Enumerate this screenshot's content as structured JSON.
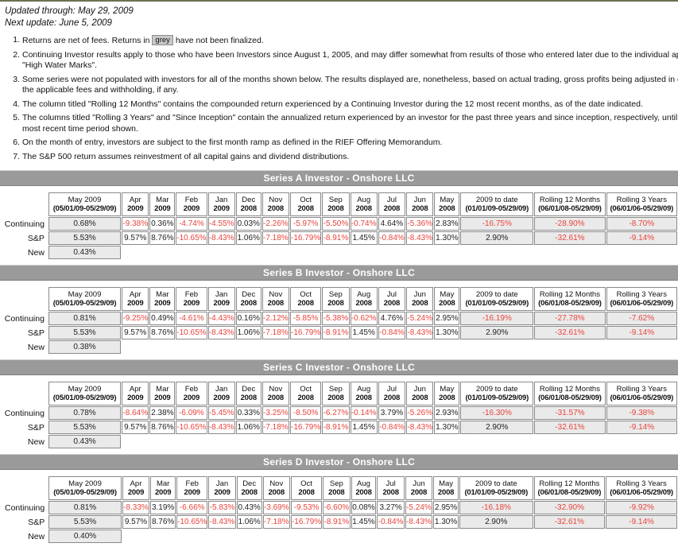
{
  "header": {
    "updated_through": "Updated through: May 29, 2009",
    "next_update": "Next update: June 5, 2009"
  },
  "notes": [
    {
      "num": "1.",
      "pre": "Returns are net of fees. Returns in ",
      "chip": "grey",
      "post": " have not been finalized."
    },
    {
      "num": "2.",
      "pre": "Continuing Investor results apply to those who have been Investors since August 1, 2005, and may differ somewhat from results of those who entered later due to the individual application of \"High Water Marks\".",
      "chip": "",
      "post": ""
    },
    {
      "num": "3.",
      "pre": "Some series were not populated with investors for all of the months shown below. The results displayed are, nonetheless, based on actual trading, gross profits being adjusted in each case by the applicable fees and withholding, if any.",
      "chip": "",
      "post": ""
    },
    {
      "num": "4.",
      "pre": "The column titled \"Rolling 12 Months\" contains the compounded return experienced by a Continuing Investor during the 12 most recent months, as of the date indicated.",
      "chip": "",
      "post": ""
    },
    {
      "num": "5.",
      "pre": "The columns titled \"Rolling 3 Years\" and \"Since Inception\" contain the annualized return experienced by an investor for the past three years and since inception, respectively, until the end of the most recent time period shown.",
      "chip": "",
      "post": ""
    },
    {
      "num": "6.",
      "pre": "On the month of entry, investors are subject to the first month ramp as defined in the RIEF Offering Memorandum.",
      "chip": "",
      "post": ""
    },
    {
      "num": "7.",
      "pre": "The S&P 500 return assumes reinvestment of all capital gains and dividend distributions.",
      "chip": "",
      "post": ""
    }
  ],
  "columns": {
    "may": {
      "line1": "May 2009",
      "line2": "(05/01/09-05/29/09)"
    },
    "months": [
      {
        "line1": "Apr",
        "line2": "2009"
      },
      {
        "line1": "Mar",
        "line2": "2009"
      },
      {
        "line1": "Feb",
        "line2": "2009"
      },
      {
        "line1": "Jan",
        "line2": "2009"
      },
      {
        "line1": "Dec",
        "line2": "2008"
      },
      {
        "line1": "Nov",
        "line2": "2008"
      },
      {
        "line1": "Oct",
        "line2": "2008"
      },
      {
        "line1": "Sep",
        "line2": "2008"
      },
      {
        "line1": "Aug",
        "line2": "2008"
      },
      {
        "line1": "Jul",
        "line2": "2008"
      },
      {
        "line1": "Jun",
        "line2": "2008"
      },
      {
        "line1": "May",
        "line2": "2008"
      }
    ],
    "ytd": {
      "line1": "2009 to date",
      "line2": "(01/01/09-05/29/09)"
    },
    "rolling12": {
      "line1": "Rolling 12 Months",
      "line2": "(06/01/08-05/29/09)"
    },
    "rolling3y": {
      "line1": "Rolling 3 Years",
      "line2": "(06/01/06-05/29/09)"
    }
  },
  "row_labels": {
    "continuing": "Continuing",
    "sp": "S&P",
    "new": "New"
  },
  "colors": {
    "negative": "#e8443c",
    "section_bar": "#9a9a9a",
    "shaded_cell": "#e2e2e2"
  },
  "series": [
    {
      "title": "Series A Investor - Onshore LLC",
      "continuing": {
        "may": "0.68%",
        "months": [
          "-9.38%",
          "0.36%",
          "-4.74%",
          "-4.55%",
          "0.03%",
          "-2.26%",
          "-5.97%",
          "-5.50%",
          "-0.74%",
          "4.64%",
          "-5.36%",
          "2.83%"
        ],
        "ytd": "-16.75%",
        "rolling12": "-28.90%",
        "rolling3y": "-8.70%"
      },
      "sp": {
        "may": "5.53%",
        "months": [
          "9.57%",
          "8.76%",
          "-10.65%",
          "-8.43%",
          "1.06%",
          "-7.18%",
          "-16.79%",
          "-8.91%",
          "1.45%",
          "-0.84%",
          "-8.43%",
          "1.30%"
        ],
        "ytd": "2.90%",
        "rolling12": "-32.61%",
        "rolling3y": "-9.14%"
      },
      "new": {
        "may": "0.43%"
      }
    },
    {
      "title": "Series B Investor - Onshore LLC",
      "continuing": {
        "may": "0.81%",
        "months": [
          "-9.25%",
          "0.49%",
          "-4.61%",
          "-4.43%",
          "0.16%",
          "-2.12%",
          "-5.85%",
          "-5.38%",
          "-0.62%",
          "4.76%",
          "-5.24%",
          "2.95%"
        ],
        "ytd": "-16.19%",
        "rolling12": "-27.78%",
        "rolling3y": "-7.62%"
      },
      "sp": {
        "may": "5.53%",
        "months": [
          "9.57%",
          "8.76%",
          "-10.65%",
          "-8.43%",
          "1.06%",
          "-7.18%",
          "-16.79%",
          "-8.91%",
          "1.45%",
          "-0.84%",
          "-8.43%",
          "1.30%"
        ],
        "ytd": "2.90%",
        "rolling12": "-32.61%",
        "rolling3y": "-9.14%"
      },
      "new": {
        "may": "0.38%"
      }
    },
    {
      "title": "Series C Investor - Onshore LLC",
      "continuing": {
        "may": "0.78%",
        "months": [
          "-8.64%",
          "2.38%",
          "-6.09%",
          "-5.45%",
          "0.33%",
          "-3.25%",
          "-8.50%",
          "-6.27%",
          "-0.14%",
          "3.79%",
          "-5.26%",
          "2.93%"
        ],
        "ytd": "-16.30%",
        "rolling12": "-31.57%",
        "rolling3y": "-9.38%"
      },
      "sp": {
        "may": "5.53%",
        "months": [
          "9.57%",
          "8.76%",
          "-10.65%",
          "-8.43%",
          "1.06%",
          "-7.18%",
          "-16.79%",
          "-8.91%",
          "1.45%",
          "-0.84%",
          "-8.43%",
          "1.30%"
        ],
        "ytd": "2.90%",
        "rolling12": "-32.61%",
        "rolling3y": "-9.14%"
      },
      "new": {
        "may": "0.43%"
      }
    },
    {
      "title": "Series D Investor - Onshore LLC",
      "continuing": {
        "may": "0.81%",
        "months": [
          "-8.33%",
          "3.19%",
          "-6.66%",
          "-5.83%",
          "0.43%",
          "-3.69%",
          "-9.53%",
          "-6.60%",
          "0.08%",
          "3.27%",
          "-5.24%",
          "2.95%"
        ],
        "ytd": "-16.18%",
        "rolling12": "-32.90%",
        "rolling3y": "-9.92%"
      },
      "sp": {
        "may": "5.53%",
        "months": [
          "9.57%",
          "8.76%",
          "-10.65%",
          "-8.43%",
          "1.06%",
          "-7.18%",
          "-16.79%",
          "-8.91%",
          "1.45%",
          "-0.84%",
          "-8.43%",
          "1.30%"
        ],
        "ytd": "2.90%",
        "rolling12": "-32.61%",
        "rolling3y": "-9.14%"
      },
      "new": {
        "may": "0.40%"
      }
    }
  ]
}
